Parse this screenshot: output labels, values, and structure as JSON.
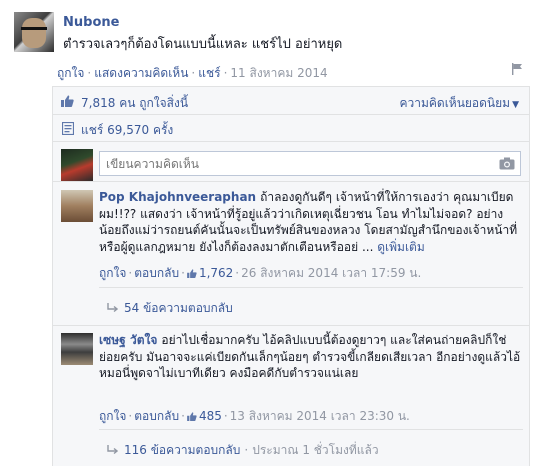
{
  "post": {
    "author": "Nubone",
    "text": "ตำรวจเลวๆก็ต้องโดนแบบนี้แหละ แชร์ไป อย่าหยุด",
    "actions": {
      "like": "ถูกใจ",
      "comment": "แสดงความคิดเห็น",
      "share": "แชร์",
      "date": "11 สิงหาคม 2014"
    }
  },
  "ufi": {
    "likes_count": "7,818",
    "likes_suffix": "คน ถูกใจสิ่งนี้",
    "top_comments_label": "ความคิดเห็นยอดนิยม",
    "shares_label": "แชร์ 69,570 ครั้ง",
    "composer_placeholder": "เขียนความคิดเห็น"
  },
  "comments": [
    {
      "author": "Pop Khajohnveeraphan",
      "text": "ถ้าลองดูกันดีๆ เจ้าหน้าที่ให้การเองว่า คุณมาเบียดผม!!?? แสดงว่า เจ้าหน้าที่รู้อยู่แล้วว่าเกิดเหตุเฉี่ยวชน โอน ทำไมไม่จอด? อย่างน้อยถึงแม่ว่ารถยนต์คันนั้นจะเป็นทรัพย์สินของหลวง โดยสามัญสำนึกของเจ้าหน้าที่ หรือผู้ดูแลกฎหมาย ยังไงก็ต้องลงมาตักเตือนหรืออย่ ...",
      "see_more": "ดูเพิ่มเติม",
      "like": "ถูกใจ",
      "reply": "ตอบกลับ",
      "like_count": "1,762",
      "timestamp": "26 สิงหาคม 2014 เวลา 17:59 น.",
      "replies": "54 ข้อความตอบกลับ"
    },
    {
      "author": "เซษฐ วัตใจ",
      "text": "อย่าไปเชื่อมากครับ ไอ้คลิปแบบนี้ต้องดูยาวๆ และใส่คนถ่ายคลิปก็ใช่ย่อยครับ มันอาจจะแค่เบียดกันเล็กๆน้อยๆ ตำรวจขี้เกลียดเสียเวลา อีกอย่างดูแล้วไอ้หมอนี่พูดจาไม่เบาทีเดียว คงมือคดีกับตำรวจแน่เลย",
      "like": "ถูกใจ",
      "reply": "ตอบกลับ",
      "like_count": "485",
      "timestamp": "13 สิงหาคม 2014 เวลา 23:30 น.",
      "replies": "116 ข้อความตอบกลับ",
      "replies_time": "ประมาณ 1 ชั่วโมงที่แล้ว"
    }
  ],
  "colors": {
    "link": "#3b5998",
    "meta": "#9197a3",
    "ufi_bg": "#f6f7f9",
    "border": "#e1e2e3"
  },
  "icons": [
    "flag-icon",
    "like-thumb-icon",
    "share-icon",
    "camera-icon",
    "reply-arrow-icon",
    "caret-down-icon"
  ]
}
